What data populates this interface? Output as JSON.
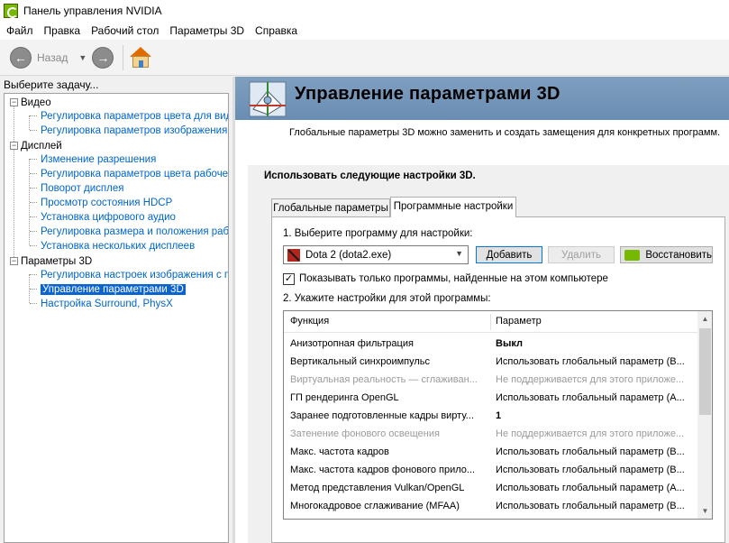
{
  "window": {
    "title": "Панель управления NVIDIA"
  },
  "menu": [
    "Файл",
    "Правка",
    "Рабочий стол",
    "Параметры 3D",
    "Справка"
  ],
  "toolbar": {
    "back_label": "Назад"
  },
  "sidebar": {
    "header": "Выберите задачу...",
    "categories": [
      {
        "label": "Видео",
        "items": [
          "Регулировка параметров цвета для вид",
          "Регулировка параметров изображения д"
        ]
      },
      {
        "label": "Дисплей",
        "items": [
          "Изменение разрешения",
          "Регулировка параметров цвета рабочег",
          "Поворот дисплея",
          "Просмотр состояния HDCP",
          "Установка цифрового аудио",
          "Регулировка размера и положения рабо",
          "Установка нескольких дисплеев"
        ]
      },
      {
        "label": "Параметры 3D",
        "items": [
          "Регулировка настроек изображения с пр",
          "Управление параметрами 3D",
          "Настройка Surround, PhysX"
        ]
      }
    ],
    "selected": "Управление параметрами 3D"
  },
  "page": {
    "title": "Управление параметрами 3D",
    "subtitle": "Глобальные параметры 3D можно заменить и создать замещения для конкретных программ.",
    "section_heading": "Использовать следующие настройки 3D.",
    "tabs": [
      "Глобальные параметры",
      "Программные настройки"
    ],
    "active_tab": "Программные настройки",
    "step1_label": "1. Выберите программу для настройки:",
    "program_selected": "Dota 2 (dota2.exe)",
    "buttons": {
      "add": "Добавить",
      "remove": "Удалить",
      "restore": "Восстановить"
    },
    "checkbox_label": "Показывать только программы, найденные на этом компьютере",
    "checkbox_checked": true,
    "step2_label": "2. Укажите настройки для этой программы:",
    "grid": {
      "col_function": "Функция",
      "col_parameter": "Параметр",
      "rows": [
        {
          "function": "Анизотропная фильтрация",
          "value": "Выкл",
          "bold": true,
          "disabled": false
        },
        {
          "function": "Вертикальный синхроимпульс",
          "value": "Использовать глобальный параметр (В...",
          "bold": false,
          "disabled": false
        },
        {
          "function": "Виртуальная реальность — сглаживан...",
          "value": "Не поддерживается для этого приложе...",
          "bold": false,
          "disabled": true
        },
        {
          "function": "ГП рендеринга OpenGL",
          "value": "Использовать глобальный параметр (А...",
          "bold": false,
          "disabled": false
        },
        {
          "function": "Заранее подготовленные кадры вирту...",
          "value": "1",
          "bold": true,
          "disabled": false
        },
        {
          "function": "Затенение фонового освещения",
          "value": "Не поддерживается для этого приложе...",
          "bold": false,
          "disabled": true
        },
        {
          "function": "Макс. частота кадров",
          "value": "Использовать глобальный параметр (В...",
          "bold": false,
          "disabled": false
        },
        {
          "function": "Макс. частота кадров фонового прило...",
          "value": "Использовать глобальный параметр (В...",
          "bold": false,
          "disabled": false
        },
        {
          "function": "Метод представления Vulkan/OpenGL",
          "value": "Использовать глобальный параметр (А...",
          "bold": false,
          "disabled": false
        },
        {
          "function": "Многокадровое сглаживание (MFAA)",
          "value": "Использовать глобальный параметр (В...",
          "bold": false,
          "disabled": false
        }
      ]
    }
  },
  "colors": {
    "accent": "#0a64d0",
    "link": "#0066cc",
    "nvidia_green": "#76b900",
    "banner": "#7596b9"
  }
}
